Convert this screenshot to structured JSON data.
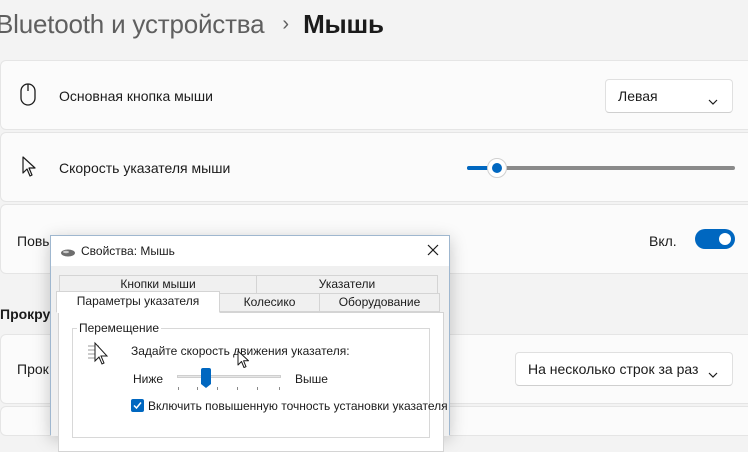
{
  "breadcrumb": {
    "parent": "Bluetooth и устройства",
    "separator": "›",
    "current": "Мышь"
  },
  "settings": {
    "primary_button": {
      "label": "Основная кнопка мыши",
      "value": "Левая"
    },
    "pointer_speed": {
      "label": "Скорость указателя мыши",
      "level": 0.08
    },
    "enhance_precision": {
      "label_partial": "Повы",
      "state_label": "Вкл.",
      "enabled": true
    },
    "scroll_section_partial": "Прокру",
    "scroll_lines": {
      "label_partial": "Прок",
      "value": "На несколько строк за раз"
    }
  },
  "dialog": {
    "title": "Свойства: Мышь",
    "tabs_row1": [
      "Кнопки мыши",
      "Указатели"
    ],
    "tabs_row2": [
      "Параметры указателя",
      "Колесико",
      "Оборудование"
    ],
    "active_tab": "Параметры указателя",
    "motion": {
      "group_title": "Перемещение",
      "prompt": "Задайте скорость движения указателя:",
      "slow_label": "Ниже",
      "fast_label": "Выше",
      "level": 0.25
    },
    "precision_checkbox": {
      "label": "Включить повышенную точность установки указателя",
      "checked": true
    }
  },
  "colors": {
    "accent": "#0067c0",
    "background": "#f3f3f3",
    "card": "#fbfbfb"
  },
  "icons": [
    "mouse-icon",
    "cursor-icon",
    "chevron-right-icon",
    "chevron-down-icon",
    "close-icon",
    "checkmark-icon"
  ]
}
